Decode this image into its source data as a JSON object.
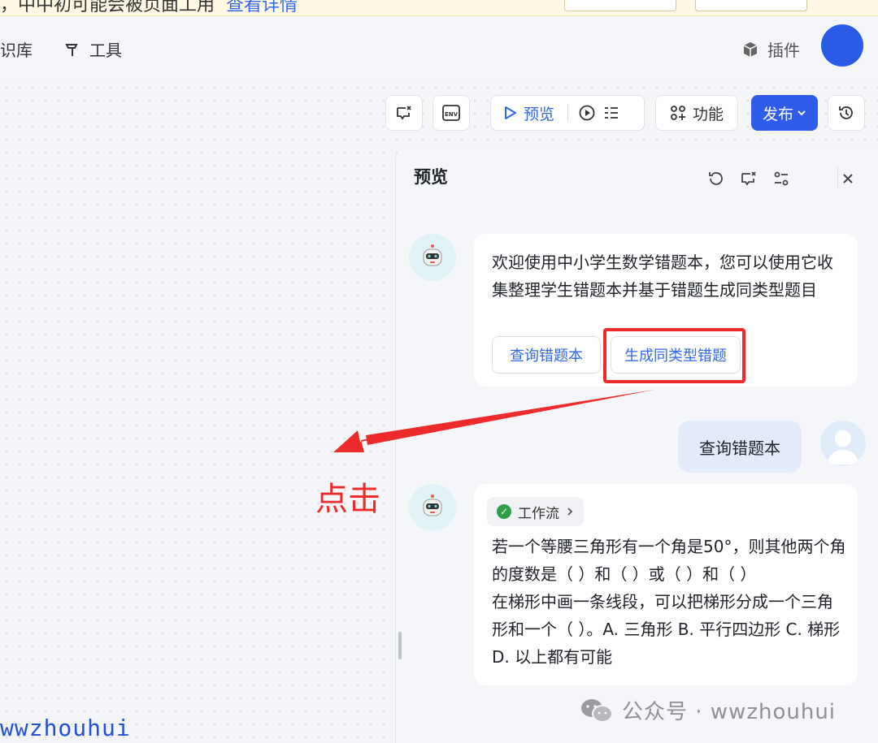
{
  "banner": {
    "text": "，中中初可能会被页面工用",
    "link": "查看详情"
  },
  "nav": {
    "knowledge_label": "识库",
    "tools_label": "工具",
    "plugin_label": "插件"
  },
  "toolbar": {
    "preview_label": "预览",
    "function_label": "功能",
    "publish_label": "发布"
  },
  "preview": {
    "title": "预览",
    "welcome_message": "欢迎使用中小学生数学错题本，您可以使用它收集整理学生错题本并基于错题生成同类型题目",
    "suggestions": [
      "查询错题本",
      "生成同类型错题"
    ],
    "user_message": "查询错题本",
    "workflow_label": "工作流",
    "answer": "若一个等腰三角形有一个角是50°，则其他两个角的度数是（ ）和（ ）或（ ）和（ ）\n在梯形中画一条线段，可以把梯形分成一个三角形和一个（ ）。A. 三角形 B. 平行四边形 C. 梯形 D. 以上都有可能"
  },
  "annotation": {
    "click_label": "点击"
  },
  "watermark": {
    "text": "公众号 · wwzhouhui"
  },
  "corner_text": "wwzhouhui",
  "colors": {
    "accent": "#2f5ce9",
    "annotation_red": "#ee2b2b",
    "avatar_blue": "#2a5ce8"
  }
}
